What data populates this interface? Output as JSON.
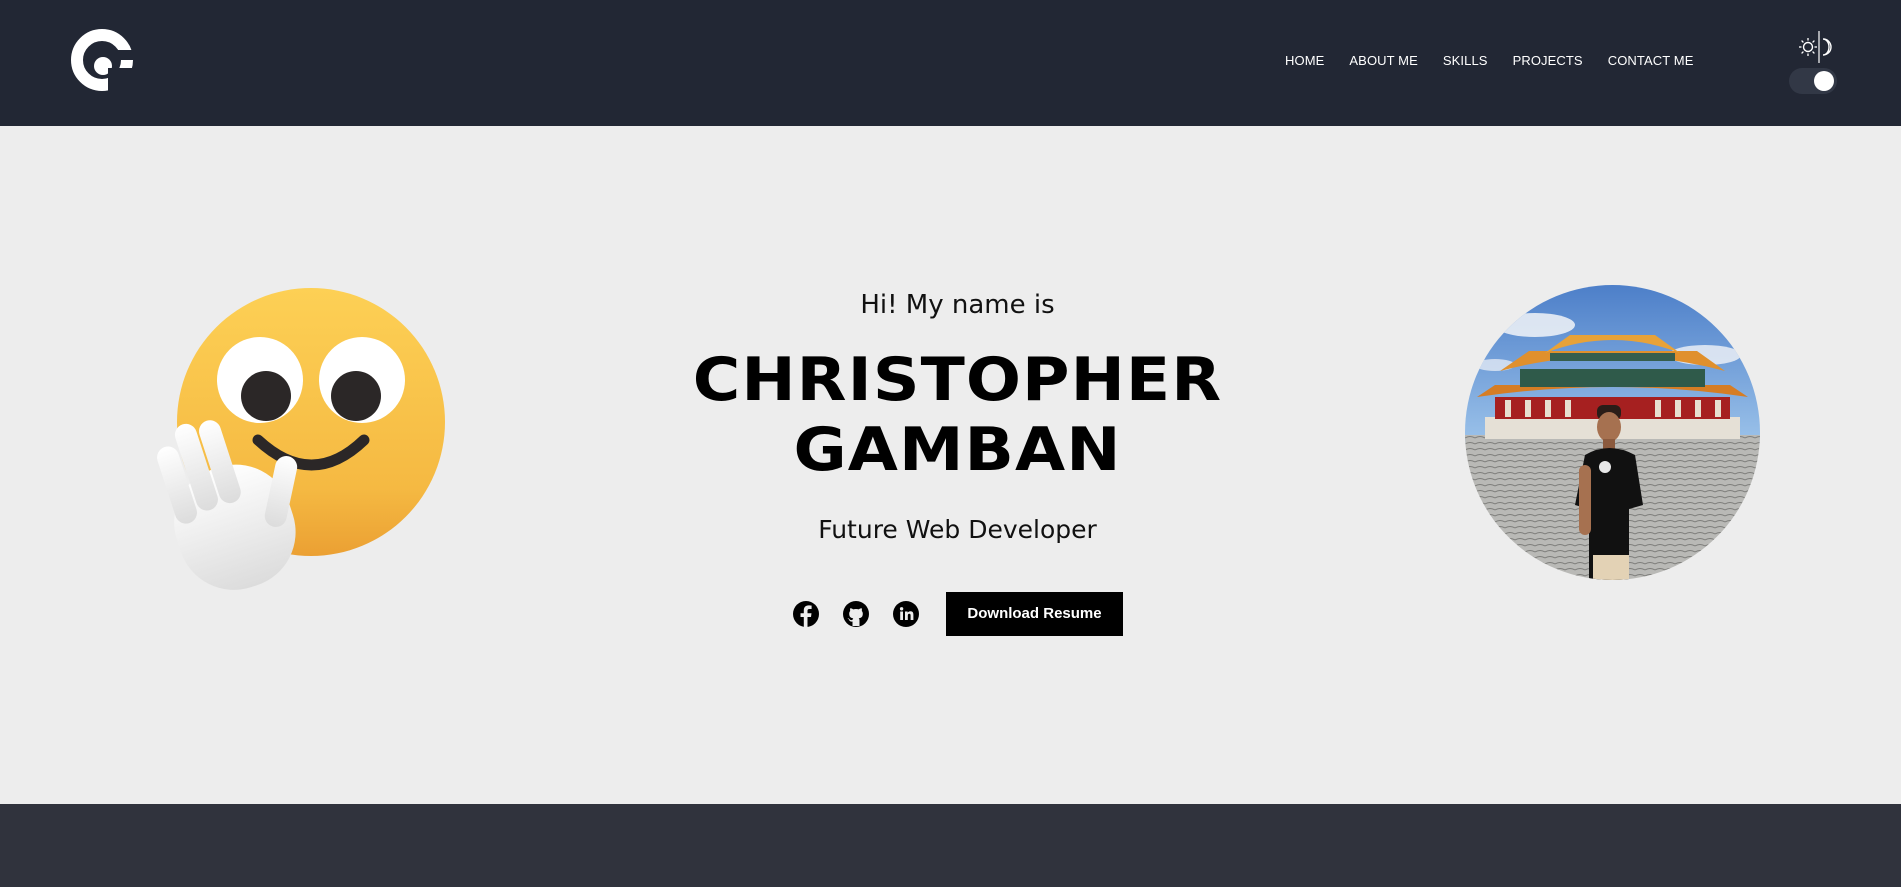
{
  "header": {
    "logo_icon": "cg-logo-icon",
    "nav": [
      {
        "label": "HOME"
      },
      {
        "label": "ABOUT ME"
      },
      {
        "label": "SKILLS"
      },
      {
        "label": "PROJECTS"
      },
      {
        "label": "CONTACT ME"
      }
    ],
    "theme_toggle": {
      "icons": [
        "sun-icon",
        "moon-icon"
      ],
      "state": "on"
    }
  },
  "hero": {
    "greeting": "Hi! My name is",
    "name": "CHRISTOPHER GAMBAN",
    "role": "Future Web Developer",
    "social": [
      "facebook-icon",
      "github-icon",
      "linkedin-icon"
    ],
    "download_label": "Download Resume",
    "emoji": "waving-smiley-emoji",
    "photo": "profile-photo"
  },
  "colors": {
    "header_bg": "#222734",
    "hero_bg": "#ededed",
    "footer_bg": "#30333d",
    "button_bg": "#000000",
    "emoji_yellow": "#f7c443"
  }
}
